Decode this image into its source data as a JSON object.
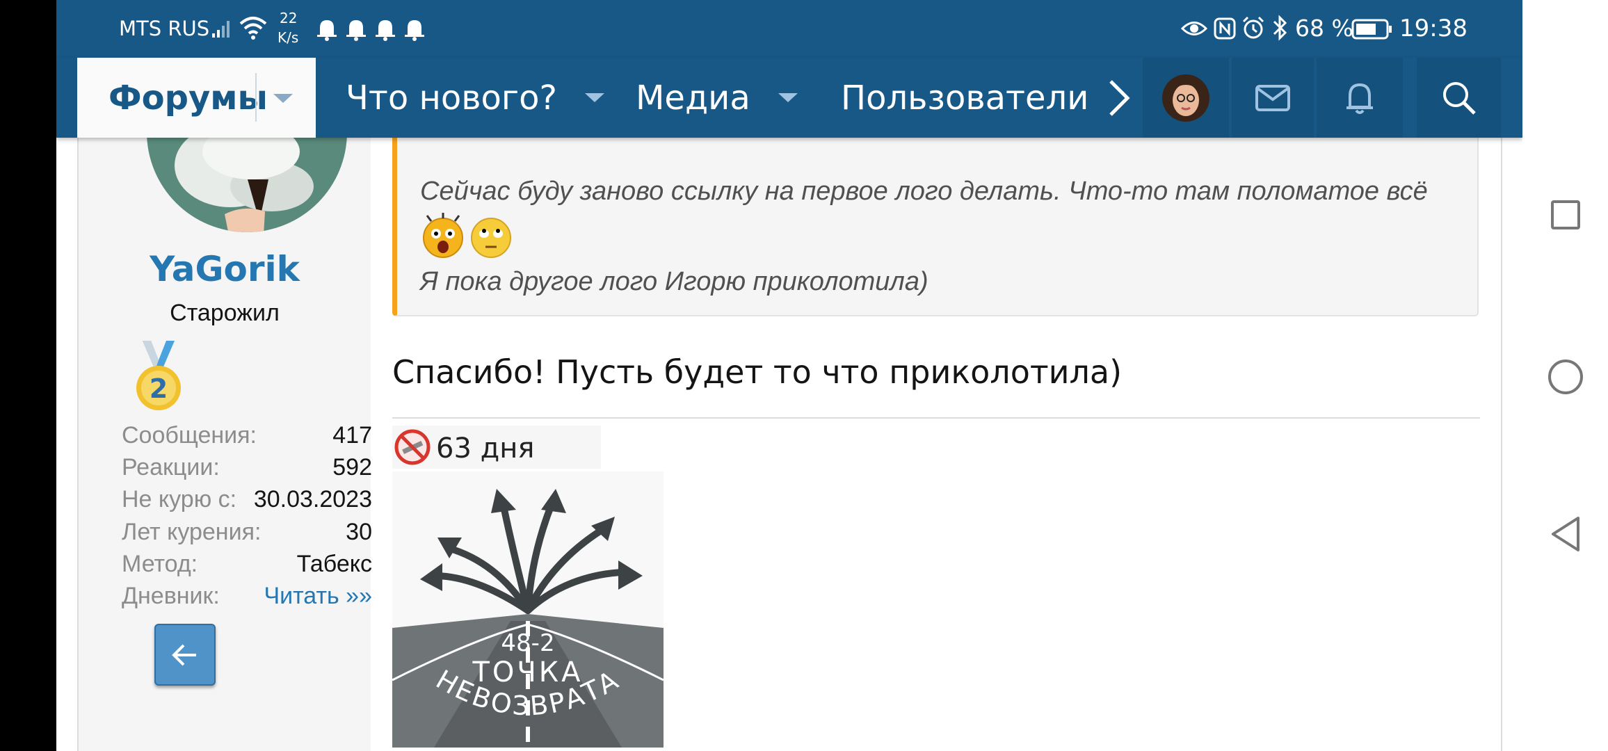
{
  "status_bar": {
    "carrier": "MTS RUS",
    "speed_value": "22",
    "speed_unit": "K/s",
    "battery": "68 %",
    "time": "19:38",
    "notification_count": 4
  },
  "nav": {
    "forums": "Форумы",
    "whats_new": "Что нового?",
    "media": "Медиа",
    "users": "Пользователи"
  },
  "user": {
    "name": "YaGorik",
    "title": "Старожил",
    "medal": "2",
    "stats": [
      {
        "key": "Сообщения:",
        "value": "417"
      },
      {
        "key": "Реакции:",
        "value": "592"
      },
      {
        "key": "Не курю с:",
        "value": "30.03.2023"
      },
      {
        "key": "Лет курения:",
        "value": "30"
      },
      {
        "key": "Метод:",
        "value": "Табекс"
      },
      {
        "key": "Дневник:",
        "value": "Читать »»"
      }
    ]
  },
  "quote": {
    "line1": "Сейчас буду заново ссылку на первое лого делать. Что-то там поломатое всё",
    "line2": "Я пока другое лого Игорю приколотила)"
  },
  "post": {
    "text": "Спасибо! Пусть будет то что приколотила)",
    "signature_days": "63 дня",
    "logo_top": "48-2",
    "logo_mid": "ТОЧКА",
    "logo_bottom": "НЕВОЗВРАТА"
  },
  "colors": {
    "header": "#185886",
    "accent": "#f7a21d",
    "link": "#2577b1",
    "username": "#2577b1"
  }
}
